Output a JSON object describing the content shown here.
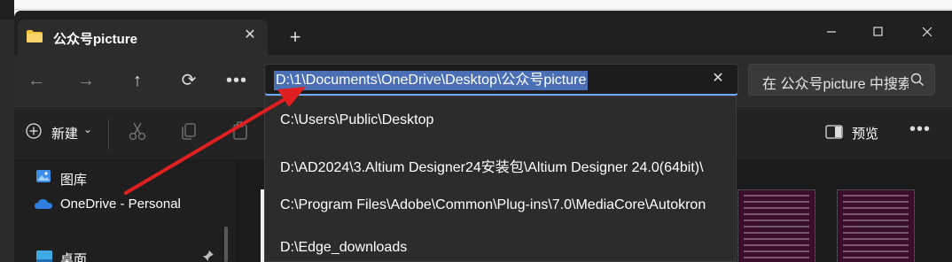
{
  "window": {
    "tab_title": "公众号picture",
    "tab_close": "✕",
    "new_tab": "+"
  },
  "nav": {
    "back": "←",
    "forward": "→",
    "up": "↑",
    "refresh": "⟳",
    "more": "•••"
  },
  "address": {
    "value": "D:\\1\\Documents\\OneDrive\\Desktop\\公众号picture",
    "clear": "✕"
  },
  "search": {
    "placeholder": "在 公众号picture 中搜索"
  },
  "toolbar": {
    "new_label": "新建",
    "new_chevron": "⌄",
    "preview_label": "预览",
    "more": "•••"
  },
  "sidebar": {
    "items": [
      {
        "label": "图库",
        "icon": "gallery-icon"
      },
      {
        "label": "OneDrive - Personal",
        "icon": "cloud-icon"
      },
      {
        "label": "桌面",
        "icon": "desktop-icon"
      }
    ]
  },
  "dropdown": {
    "items": [
      "C:\\Users\\Public\\Desktop",
      "D:\\AD2024\\3.Altium Designer24安装包\\Altium Designer 24.0(64bit)\\",
      "C:\\Program Files\\Adobe\\Common\\Plug-ins\\7.0\\MediaCore\\Autokron",
      "D:\\Edge_downloads"
    ]
  },
  "colors": {
    "accent": "#6ea8ff",
    "selection": "#4a6fb5",
    "arrow": "#e02020",
    "folder": "#f4c542"
  }
}
